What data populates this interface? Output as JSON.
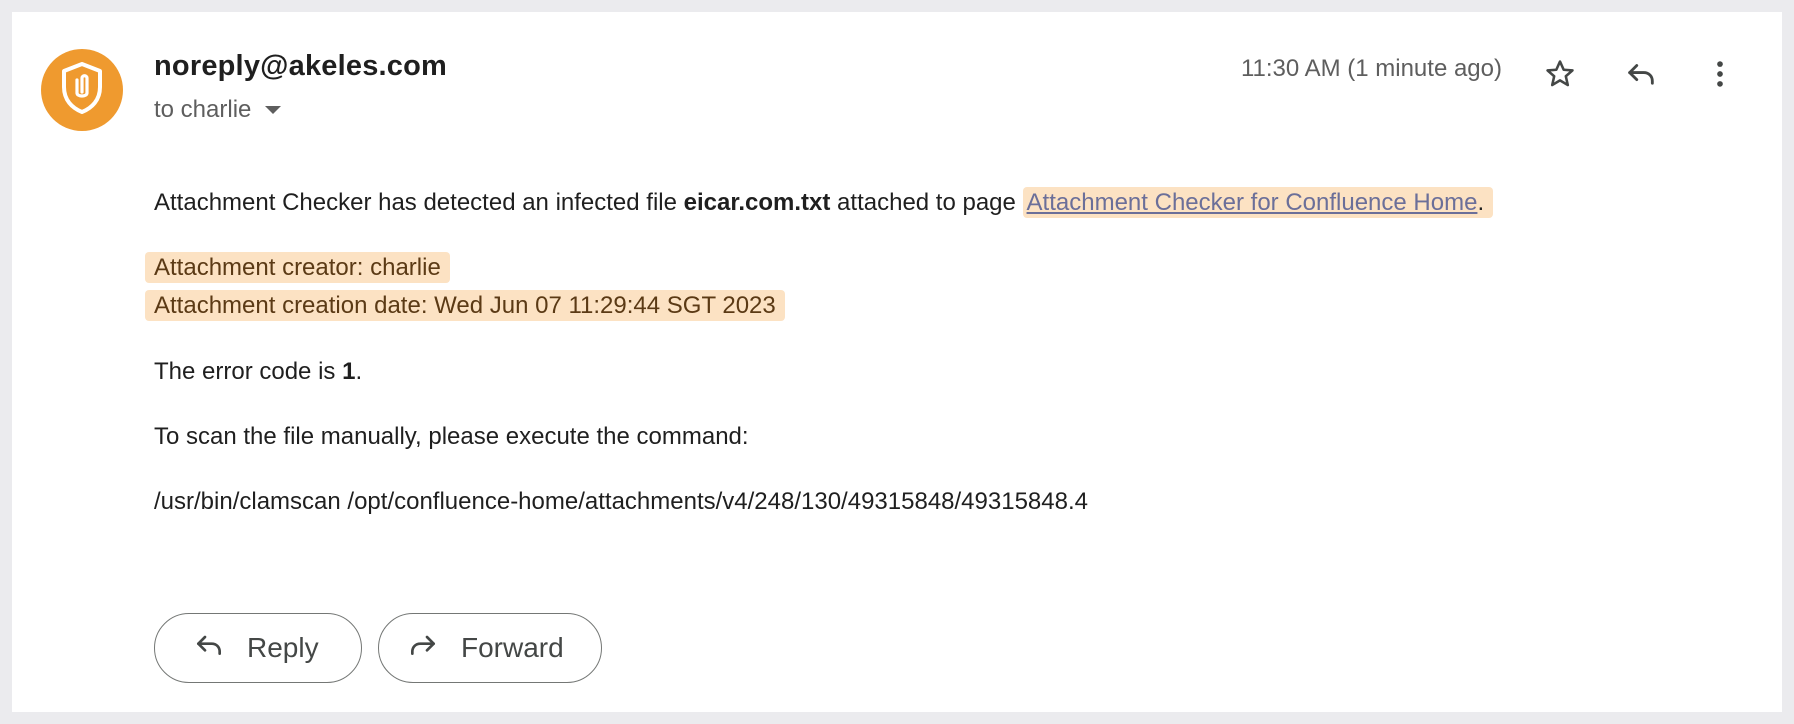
{
  "email": {
    "sender": "noreply@akeles.com",
    "recipient_label": "to charlie",
    "timestamp": "11:30 AM (1 minute ago)",
    "body": {
      "line1_prefix": "Attachment Checker has detected an infected file ",
      "infected_file": "eicar.com.txt",
      "line1_middle": " attached to page ",
      "page_link": "Attachment Checker for Confluence Home",
      "line1_suffix": ".",
      "creator": "Attachment creator: charlie",
      "creation_date": "Attachment creation date: Wed Jun 07 11:29:44 SGT 2023",
      "error_prefix": "The error code is ",
      "error_code": "1",
      "error_suffix": ".",
      "scan_instruction": "To scan the file manually, please execute the command:",
      "command": "/usr/bin/clamscan /opt/confluence-home/attachments/v4/248/130/49315848/49315848.4"
    }
  },
  "actions": {
    "reply_label": "Reply",
    "forward_label": "Forward"
  },
  "icons": {
    "avatar": "shield-paperclip-icon",
    "star": "star-icon",
    "reply": "reply-icon",
    "more": "more-vert-icon",
    "forward": "forward-icon",
    "dropdown": "caret-down-icon"
  },
  "colors": {
    "avatar_bg": "#ef9a2f",
    "highlight_bg": "#fce2c3",
    "link": "#6b6f99"
  }
}
